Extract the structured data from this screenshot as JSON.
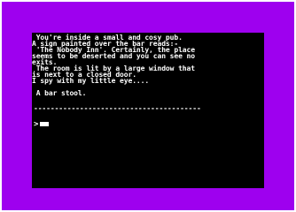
{
  "game": {
    "description_lines": [
      " You're inside a small and cosy pub.",
      "A sign painted over the bar reads:-",
      " 'The Nobody Inn'. Certainly, the place",
      "seems to be deserted and you can see no",
      "exits.",
      " The room is lit by a large window that",
      "is next to a closed door.",
      "I spy with my little eye...."
    ],
    "items_line": " A bar stool.",
    "divider": "----------------------------------------",
    "prompt_symbol": ">"
  },
  "colors": {
    "border": "#9e00ef",
    "screen": "#000000",
    "text": "#ffffff"
  }
}
